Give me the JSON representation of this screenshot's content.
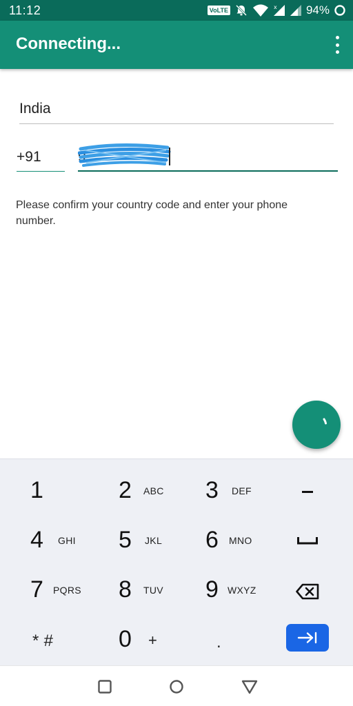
{
  "status_bar": {
    "time": "11:12",
    "network_badge": "VoLTE",
    "battery_percent": "94%",
    "icons": [
      "volte-icon",
      "mute-bell-icon",
      "wifi-icon",
      "signal-icon",
      "signal-icon",
      "battery-ring-icon"
    ]
  },
  "app_bar": {
    "title": "Connecting...",
    "menu_icon": "overflow-menu-icon"
  },
  "form": {
    "country": "India",
    "country_code": "+91",
    "phone_number_visible_prefix": "9",
    "hint": "Please confirm your country code and enter your phone number."
  },
  "fab": {
    "icon": "loading-spinner-icon",
    "color": "#148f77"
  },
  "keypad": {
    "keys": [
      {
        "digit": "1",
        "letters": ""
      },
      {
        "digit": "2",
        "letters": "ABC"
      },
      {
        "digit": "3",
        "letters": "DEF"
      },
      {
        "digit": "4",
        "letters": "GHI"
      },
      {
        "digit": "5",
        "letters": "JKL"
      },
      {
        "digit": "6",
        "letters": "MNO"
      },
      {
        "digit": "7",
        "letters": "PQRS"
      },
      {
        "digit": "8",
        "letters": "TUV"
      },
      {
        "digit": "9",
        "letters": "WXYZ"
      },
      {
        "digit": "0",
        "letters": "+"
      }
    ],
    "star_hash": "* #",
    "dot": ".",
    "dash_icon": "dash-icon",
    "space_icon": "space-icon",
    "backspace_icon": "backspace-icon",
    "next_icon": "next-field-icon",
    "next_color": "#1a66e5"
  },
  "nav_bar": {
    "icons": [
      "recents-icon",
      "home-icon",
      "back-icon"
    ]
  },
  "colors": {
    "status_bar": "#0a6b5a",
    "app_bar": "#148f77",
    "keypad_bg": "#eef0f5"
  }
}
